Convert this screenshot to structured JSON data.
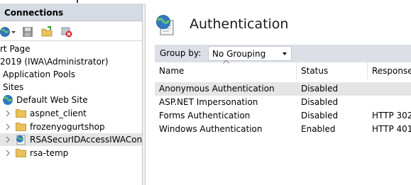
{
  "connections": {
    "title": "Connections",
    "tree": [
      {
        "label": "rt Page",
        "level": "root"
      },
      {
        "label": "2019 (IWA\\Administrator)",
        "level": "server"
      },
      {
        "label": "Application Pools",
        "level": "node"
      },
      {
        "label": "Sites",
        "level": "node"
      },
      {
        "label": "Default Web Site",
        "level": "site"
      },
      {
        "label": "aspnet_client",
        "level": "folder"
      },
      {
        "label": "frozenyogurtshop",
        "level": "folder"
      },
      {
        "label": "RSASecurIDAccessIWAConne",
        "level": "app",
        "selected": true
      },
      {
        "label": "rsa-temp",
        "level": "folder"
      }
    ]
  },
  "features": {
    "title": "Authentication",
    "group_by_label": "Group by:",
    "group_by_value": "No Grouping",
    "columns": [
      "Name",
      "Status",
      "Response T"
    ],
    "rows": [
      {
        "name": "Anonymous Authentication",
        "status": "Disabled",
        "response": ""
      },
      {
        "name": "ASP.NET Impersonation",
        "status": "Disabled",
        "response": ""
      },
      {
        "name": "Forms Authentication",
        "status": "Disabled",
        "response": "HTTP 302"
      },
      {
        "name": "Windows Authentication",
        "status": "Enabled",
        "response": "HTTP 401"
      }
    ]
  },
  "colors": {
    "header_bg": "#d5dbe3",
    "groupbar_bg": "#dce0e6",
    "selection": "#e5e5e5",
    "folder": "#e8c25a"
  }
}
